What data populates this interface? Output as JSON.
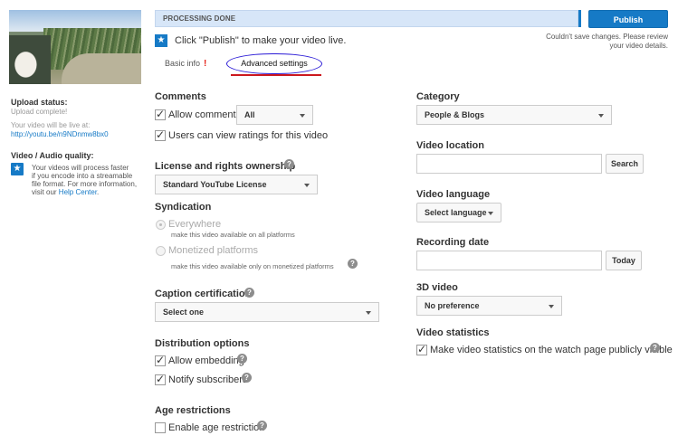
{
  "sidebar": {
    "upload_status_label": "Upload status:",
    "upload_status_value": "Upload complete!",
    "live_at_text": "Your video will be live at:",
    "video_url": "http://youtu.be/n9NDnmw8bx0",
    "quality_label": "Video / Audio quality:",
    "quality_text_1": "Your videos will process faster",
    "quality_text_2": "if you encode into a streamable",
    "quality_text_3": "file format. For more information,",
    "quality_text_4_prefix": "visit our",
    "help_center_link": "Help Center",
    "quality_text_4_suffix": "."
  },
  "header": {
    "progress_label": "PROCESSING DONE",
    "progress_percent": 100,
    "publish_label": "Publish",
    "save_error_1": "Couldn't save changes. Please review",
    "save_error_2": "your video details.",
    "hint": "Click \"Publish\" to make your video live.",
    "tabs": {
      "basic": "Basic info",
      "basic_warning": "!",
      "advanced": "Advanced settings"
    }
  },
  "left": {
    "comments": {
      "heading": "Comments",
      "allow_label": "Allow comments",
      "allow_select": "All",
      "ratings_label": "Users can view ratings for this video"
    },
    "license": {
      "heading": "License and rights ownership",
      "select": "Standard YouTube License"
    },
    "syndication": {
      "heading": "Syndication",
      "everywhere": "Everywhere",
      "everywhere_note": "make this video available on all platforms",
      "monetized": "Monetized platforms",
      "monetized_note": "make this video available only on monetized platforms"
    },
    "caption": {
      "heading": "Caption certification",
      "select": "Select one"
    },
    "distribution": {
      "heading": "Distribution options",
      "embedding": "Allow embedding",
      "notify": "Notify subscribers"
    },
    "age": {
      "heading": "Age restrictions",
      "enable": "Enable age restriction"
    }
  },
  "right": {
    "category": {
      "heading": "Category",
      "select": "People & Blogs"
    },
    "location": {
      "heading": "Video location",
      "search": "Search"
    },
    "language": {
      "heading": "Video language",
      "select": "Select language"
    },
    "recording": {
      "heading": "Recording date",
      "today": "Today"
    },
    "video3d": {
      "heading": "3D video",
      "select": "No preference"
    },
    "stats": {
      "heading": "Video statistics",
      "checkbox": "Make video statistics on the watch page publicly visible"
    }
  }
}
